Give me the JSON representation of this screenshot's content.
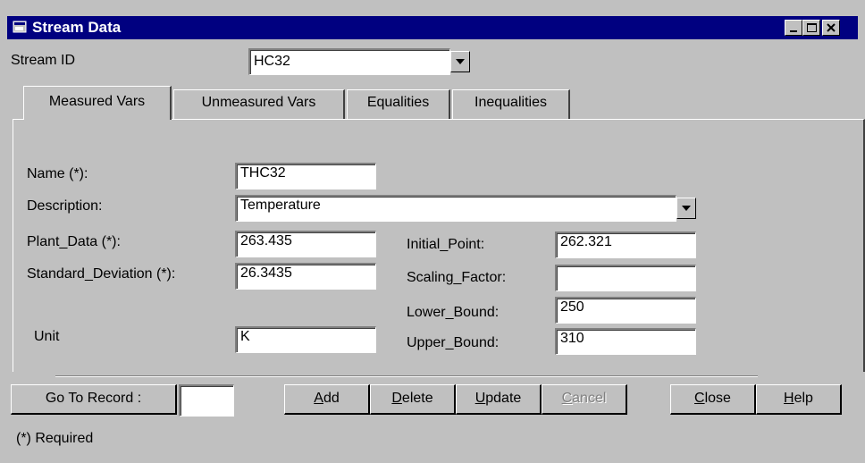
{
  "window": {
    "title": "Stream Data",
    "controls": [
      "minimize-icon",
      "maximize-icon",
      "close-icon"
    ]
  },
  "stream": {
    "label": "Stream ID",
    "value": "HC32"
  },
  "tabs": [
    {
      "label": "Measured Vars",
      "active": true
    },
    {
      "label": "Unmeasured Vars",
      "active": false
    },
    {
      "label": "Equalities",
      "active": false
    },
    {
      "label": "Inequalities",
      "active": false
    }
  ],
  "form": {
    "name_label": "Name (*):",
    "name_value": "THC32",
    "description_label": "Description:",
    "description_value": "Temperature",
    "plant_data_label": "Plant_Data (*):",
    "plant_data_value": "263.435",
    "std_dev_label": "Standard_Deviation (*):",
    "std_dev_value": "26.3435",
    "unit_label": "Unit",
    "unit_value": "K",
    "initial_point_label": "Initial_Point:",
    "initial_point_value": "262.321",
    "scaling_factor_label": "Scaling_Factor:",
    "scaling_factor_value": "",
    "lower_bound_label": "Lower_Bound:",
    "lower_bound_value": "250",
    "upper_bound_label": "Upper_Bound:",
    "upper_bound_value": "310"
  },
  "buttons": {
    "goto": "Go To Record :",
    "goto_value": "",
    "add_mn": "A",
    "add_rest": "dd",
    "delete_mn": "D",
    "delete_rest": "elete",
    "update_mn": "U",
    "update_rest": "pdate",
    "cancel_mn": "C",
    "cancel_rest": "ancel",
    "close_mn": "C",
    "close_rest": "lose",
    "help_mn": "H",
    "help_rest": "elp"
  },
  "footer": {
    "required_note": "(*)  Required"
  }
}
